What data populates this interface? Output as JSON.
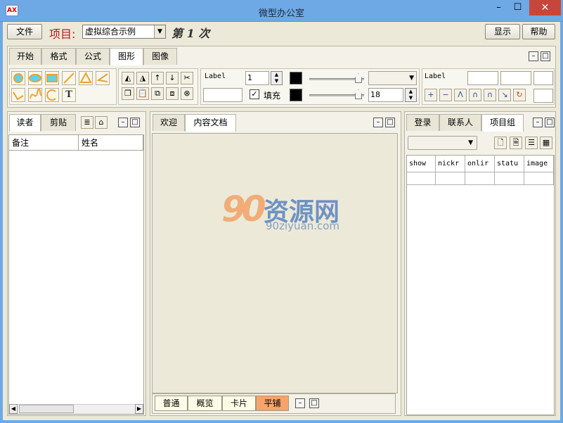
{
  "window": {
    "title": "微型办公室",
    "app_icon_text": "AX",
    "controls": {
      "minimize": "–",
      "maximize": "☐",
      "close": "✕"
    }
  },
  "topbar": {
    "file_label": "文件",
    "project_label": "项目:",
    "project_value": "虚拟综合示例",
    "session_text": "第 1 次",
    "show_label": "显示",
    "help_label": "帮助"
  },
  "ribbon": {
    "tabs": [
      {
        "label": "开始"
      },
      {
        "label": "格式"
      },
      {
        "label": "公式"
      },
      {
        "label": "图形"
      },
      {
        "label": "图像"
      }
    ],
    "active_tab": 3,
    "label_caption": "Label",
    "label_caption_2": "Label",
    "line_width": "1",
    "font_size": "18",
    "fill_label": "填充",
    "fill_checked": "✓",
    "text_tool": "T",
    "colors": {
      "shape_stroke": "#f0a030",
      "shape_fill": "#5fd3e6",
      "swatch": "#000000"
    }
  },
  "left_panel": {
    "tabs": [
      {
        "label": "读者"
      },
      {
        "label": "剪贴"
      }
    ],
    "columns": [
      "备注",
      "姓名"
    ]
  },
  "center_panel": {
    "tabs": [
      {
        "label": "欢迎"
      },
      {
        "label": "内容文档"
      }
    ],
    "view_tabs": [
      {
        "label": "普通"
      },
      {
        "label": "概览"
      },
      {
        "label": "卡片"
      },
      {
        "label": "平铺"
      }
    ],
    "active_view": 3,
    "watermark": {
      "numeral": "90",
      "brand": "资源网",
      "url": "90ziyuan.com"
    }
  },
  "right_panel": {
    "tabs": [
      {
        "label": "登录"
      },
      {
        "label": "联系人"
      },
      {
        "label": "项目组"
      }
    ],
    "columns": [
      "show",
      "nickr",
      "onlir",
      "statu",
      "image"
    ]
  }
}
